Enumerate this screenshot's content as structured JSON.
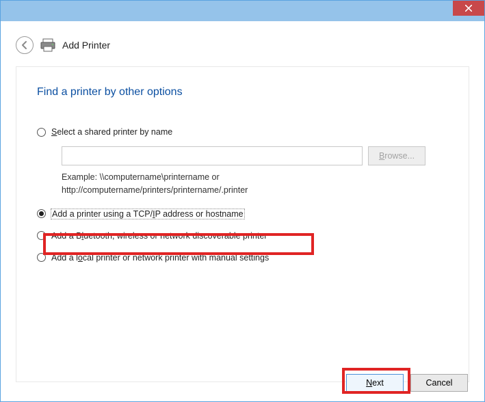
{
  "header": {
    "title": "Add Printer"
  },
  "wizard": {
    "heading": "Find a printer by other options"
  },
  "options": {
    "shared": {
      "label_pre": "S",
      "label_rest": "elect a shared printer by name",
      "input_value": "",
      "browse_pre": "B",
      "browse_rest": "rowse...",
      "example_line1": "Example: \\\\computername\\printername or",
      "example_line2": "http://computername/printers/printername/.printer"
    },
    "tcpip": {
      "label_pre": "Add a printer using a TCP/",
      "label_underline": "I",
      "label_rest": "P address or hostname"
    },
    "bluetooth": {
      "label_pre": "Add a B",
      "label_underline": "l",
      "label_rest": "uetooth, wireless or network discoverable printer"
    },
    "local": {
      "label_pre": "Add a l",
      "label_underline": "o",
      "label_rest": "cal printer or network printer with manual settings"
    }
  },
  "buttons": {
    "next_underline": "N",
    "next_rest": "ext",
    "cancel": "Cancel"
  }
}
